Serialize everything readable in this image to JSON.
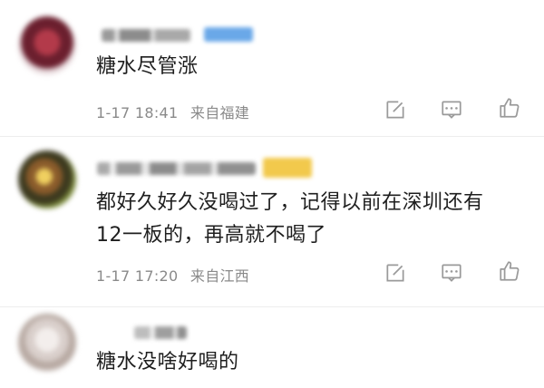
{
  "comments": [
    {
      "text_lines": [
        "糖水尽管涨"
      ],
      "date": "1-17 18:41",
      "location": "来自福建",
      "actions": [
        "edit-icon",
        "comment-icon",
        "like-icon"
      ]
    },
    {
      "text_lines": [
        "都好久好久没喝过了，记得以前在深圳还有",
        "12一板的，再高就不喝了"
      ],
      "date": "1-17 17:20",
      "location": "来自江西",
      "actions": [
        "edit-icon",
        "comment-icon",
        "like-icon"
      ]
    },
    {
      "text_lines": [
        "糖水没啥好喝的"
      ]
    }
  ],
  "colors": {
    "meta_text": "#8a8a8a",
    "body_text": "#1e1e1e",
    "icon": "#9a9a9a",
    "badge": "#6aa8e8",
    "badge_gold": "#f2c94c"
  }
}
